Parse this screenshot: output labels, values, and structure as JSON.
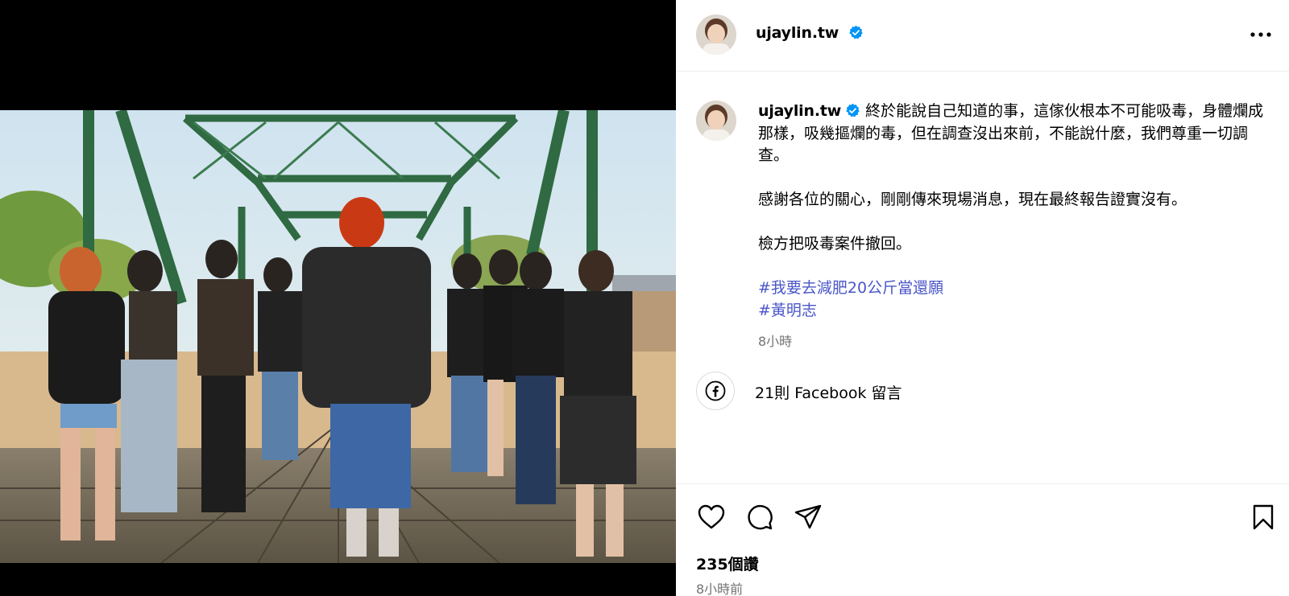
{
  "post": {
    "username": "ujaylin.tw",
    "verified": true,
    "caption": {
      "paragraphs": [
        "終於能說自己知道的事，這傢伙根本不可能吸毒，身體爛成那樣，吸幾摳爛的毒，但在調查沒出來前，不能說什麼，我們尊重一切調查。",
        "感謝各位的關心，剛剛傳來現場消息，現在最終報告證實沒有。",
        "檢方把吸毒案件撤回。"
      ],
      "hashtags": [
        "#我要去減肥20公斤當還願",
        "#黃明志"
      ],
      "time": "8小時"
    },
    "facebook_comments": "21則 Facebook 留言",
    "likes": "235個讚",
    "posted": "8小時前"
  },
  "colors": {
    "verified_badge": "#0095f6",
    "hashtag": "#4a56c9",
    "secondary_text": "#737373",
    "bridge_green": "#2f6a42"
  },
  "icons": {
    "more": "more-options-icon",
    "verified": "verified-badge-icon",
    "facebook": "facebook-icon",
    "like": "heart-icon",
    "comment": "comment-bubble-icon",
    "share": "paper-plane-icon",
    "save": "bookmark-icon"
  }
}
